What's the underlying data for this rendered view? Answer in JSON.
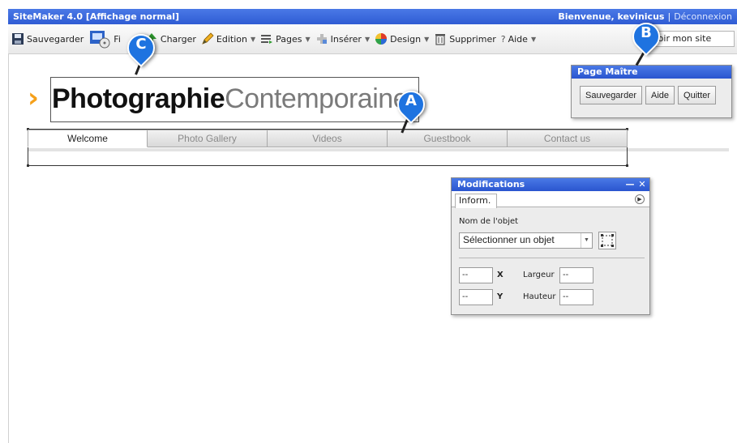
{
  "app": {
    "title": "SiteMaker 4.0  [Affichage normal]",
    "welcome": "Bienvenue, kevinicus",
    "separator": "|",
    "logout": "Déconnexion"
  },
  "toolbar": {
    "save": "Sauvegarder",
    "files": "Fi",
    "load": "Charger",
    "edit": "Edition",
    "pages": "Pages",
    "insert": "Insérer",
    "design": "Design",
    "delete": "Supprimer",
    "help": "Aide",
    "view_site": "Voir mon site"
  },
  "site": {
    "logo_bold": "Photographie",
    "logo_light": "Contemporaine",
    "nav": [
      "Welcome",
      "Photo Gallery",
      "Videos",
      "Guestbook",
      "Contact us"
    ]
  },
  "master_panel": {
    "title": "Page Maître",
    "save": "Sauvegarder",
    "help": "Aide",
    "quit": "Quitter"
  },
  "modifications": {
    "title": "Modifications",
    "minimize": "—",
    "close": "✕",
    "tab": "Inform.",
    "object_name_label": "Nom de l'objet",
    "object_select": "Sélectionner un objet",
    "x_value": "--",
    "x_label": "X",
    "y_value": "--",
    "y_label": "Y",
    "width_label": "Largeur",
    "width_value": "--",
    "height_label": "Hauteur",
    "height_value": "--"
  },
  "markers": {
    "a": "A",
    "b": "B",
    "c": "C"
  },
  "colors": {
    "titlebar": "#2f5cd4",
    "logo_chevron": "#f5a01a",
    "marker": "#1e73e0"
  }
}
